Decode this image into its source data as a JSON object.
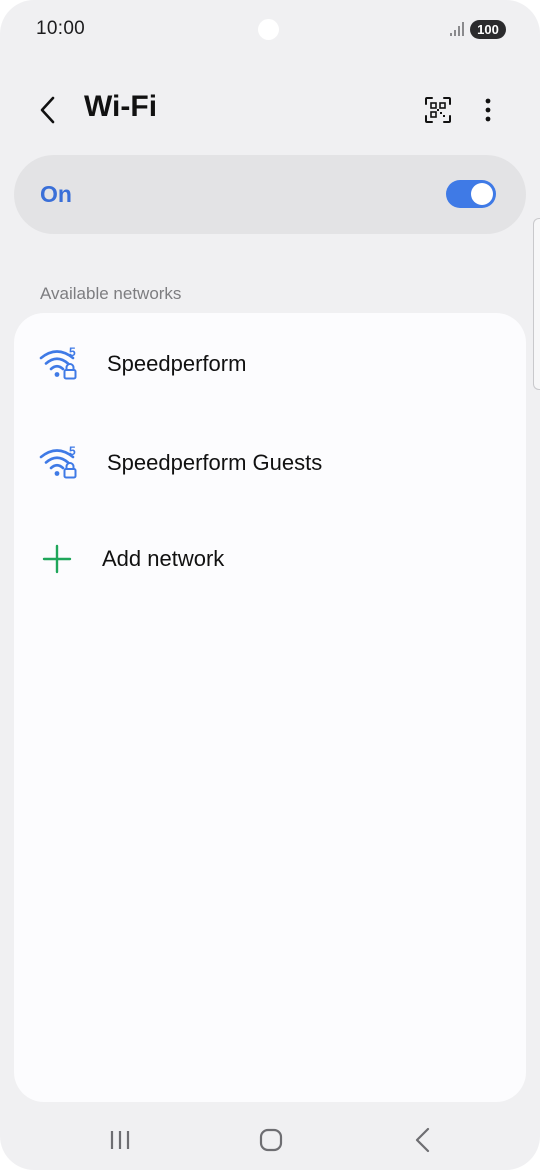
{
  "status_bar": {
    "time": "10:00",
    "battery": "100"
  },
  "header": {
    "title": "Wi-Fi"
  },
  "wifi_toggle": {
    "label": "On",
    "enabled": true,
    "accent_color": "#3f7ae6"
  },
  "available_networks": {
    "section_label": "Available networks",
    "networks": [
      {
        "name": "Speedperform",
        "band": "5",
        "secured": true
      },
      {
        "name": "Speedperform Guests",
        "band": "5",
        "secured": true
      }
    ],
    "add_network_label": "Add network"
  },
  "icons": {
    "back": "back-arrow-icon",
    "qr": "qr-scan-icon",
    "more": "more-vertical-icon",
    "wifi": "wifi-lock-icon",
    "add": "plus-icon"
  },
  "colors": {
    "wifi_icon": "#3f7ae6",
    "add_icon": "#1fa65a",
    "background": "#f0f0f2",
    "card": "#fcfcfe"
  }
}
